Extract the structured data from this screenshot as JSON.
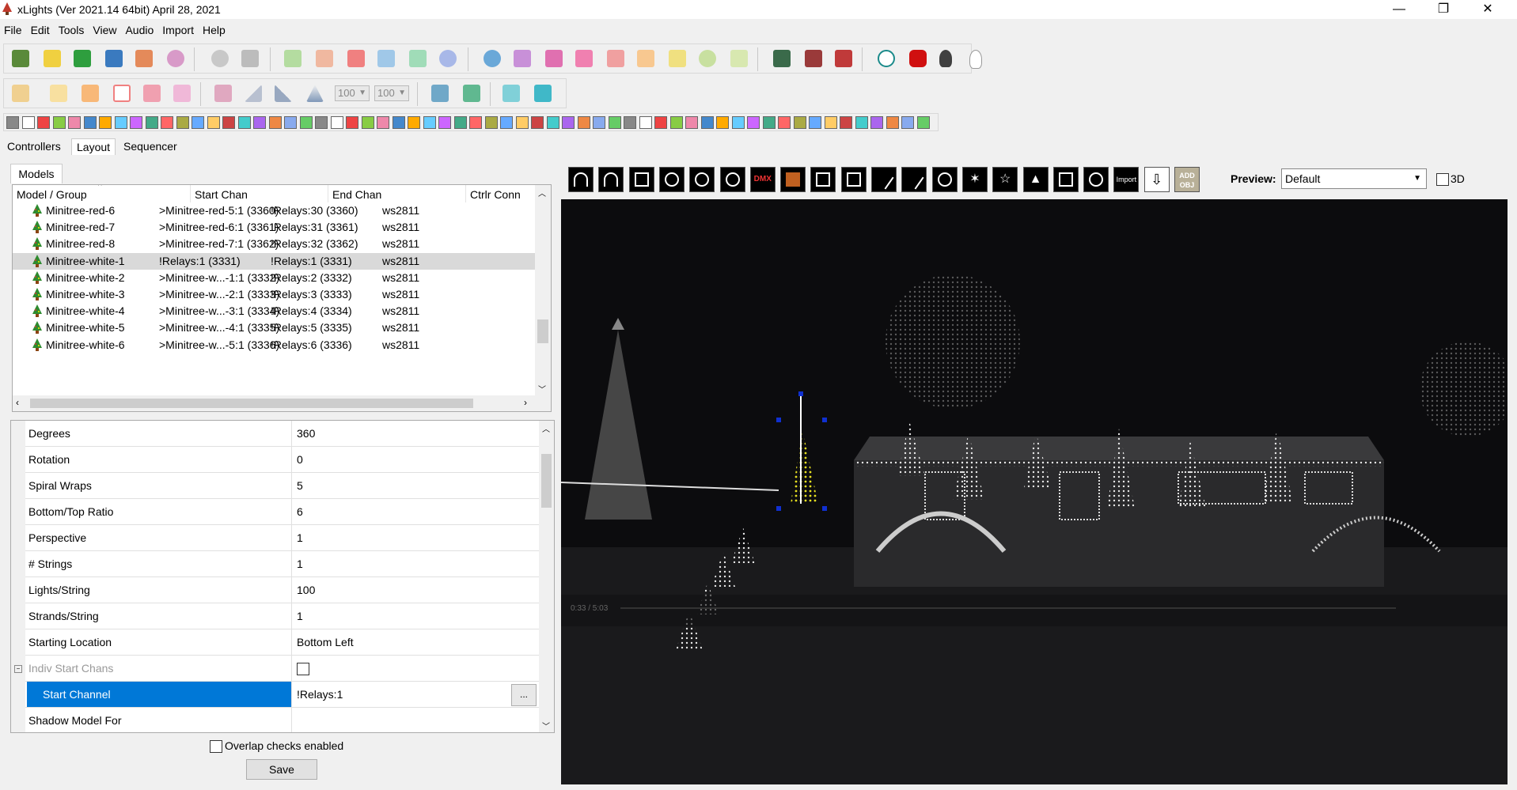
{
  "window": {
    "title": "xLights (Ver 2021.14 64bit) April 28, 2021",
    "controls": [
      "—",
      "❐",
      "✕"
    ]
  },
  "menu": [
    "File",
    "Edit",
    "Tools",
    "View",
    "Audio",
    "Import",
    "Help"
  ],
  "toolbar2": {
    "combo1": "100",
    "combo2": "100"
  },
  "tabs": [
    "Controllers",
    "Layout",
    "Sequencer"
  ],
  "left": {
    "models_tab": "Models",
    "columns": [
      "Model / Group",
      "Start Chan",
      "End Chan",
      "Ctrlr Conn"
    ],
    "rows": [
      {
        "name": "Minitree-red-6",
        "start": ">Minitree-red-5:1 (3360)",
        "end": "!Relays:30 (3360)",
        "conn": "ws2811",
        "selected": false
      },
      {
        "name": "Minitree-red-7",
        "start": ">Minitree-red-6:1 (3361)",
        "end": "!Relays:31 (3361)",
        "conn": "ws2811",
        "selected": false
      },
      {
        "name": "Minitree-red-8",
        "start": ">Minitree-red-7:1 (3362)",
        "end": "!Relays:32 (3362)",
        "conn": "ws2811",
        "selected": false
      },
      {
        "name": "Minitree-white-1",
        "start": "!Relays:1 (3331)",
        "end": "!Relays:1 (3331)",
        "conn": "ws2811",
        "selected": true
      },
      {
        "name": "Minitree-white-2",
        "start": ">Minitree-w...-1:1 (3332)",
        "end": "!Relays:2 (3332)",
        "conn": "ws2811",
        "selected": false
      },
      {
        "name": "Minitree-white-3",
        "start": ">Minitree-w...-2:1 (3333)",
        "end": "!Relays:3 (3333)",
        "conn": "ws2811",
        "selected": false
      },
      {
        "name": "Minitree-white-4",
        "start": ">Minitree-w...-3:1 (3334)",
        "end": "!Relays:4 (3334)",
        "conn": "ws2811",
        "selected": false
      },
      {
        "name": "Minitree-white-5",
        "start": ">Minitree-w...-4:1 (3335)",
        "end": "!Relays:5 (3335)",
        "conn": "ws2811",
        "selected": false
      },
      {
        "name": "Minitree-white-6",
        "start": ">Minitree-w...-5:1 (3336)",
        "end": "!Relays:6 (3336)",
        "conn": "ws2811",
        "selected": false
      }
    ],
    "properties": [
      {
        "name": "Degrees",
        "value": "360"
      },
      {
        "name": "Rotation",
        "value": "0"
      },
      {
        "name": "Spiral Wraps",
        "value": "5"
      },
      {
        "name": "Bottom/Top Ratio",
        "value": "6"
      },
      {
        "name": "Perspective",
        "value": "1"
      },
      {
        "name": "# Strings",
        "value": "1"
      },
      {
        "name": "Lights/String",
        "value": "100"
      },
      {
        "name": "Strands/String",
        "value": "1"
      },
      {
        "name": "Starting Location",
        "value": "Bottom Left"
      },
      {
        "name": "Indiv Start Chans",
        "value": ""
      },
      {
        "name": "Start Channel",
        "value": "!Relays:1"
      },
      {
        "name": "Shadow Model For",
        "value": ""
      }
    ],
    "start_channel_btn": "...",
    "overlap_label": "Overlap checks enabled",
    "save_label": "Save"
  },
  "right": {
    "model_buttons": [
      "arch",
      "candy-cane",
      "window-frame",
      "circle",
      "sphere",
      "wreath",
      "DMX",
      "custom",
      "icicles",
      "matrix",
      "single-line",
      "poly-line",
      "sphere-3d",
      "spinner",
      "star",
      "tree",
      "cube",
      "circle-outline",
      "Import",
      "download",
      "ADD OBJ"
    ],
    "dmx_label": "DMX",
    "import_label": "Import",
    "addobj_label": "ADD OBJ",
    "preview_label": "Preview:",
    "preview_value": "Default",
    "label_3d": "3D",
    "video_time": "0:33 / 5:03"
  },
  "colors": {
    "selection_blue": "#0078d7",
    "tree_green": "#2e8b2e",
    "preview_bg": "#0c0c0e",
    "highlight_yellow": "#e6e020"
  }
}
